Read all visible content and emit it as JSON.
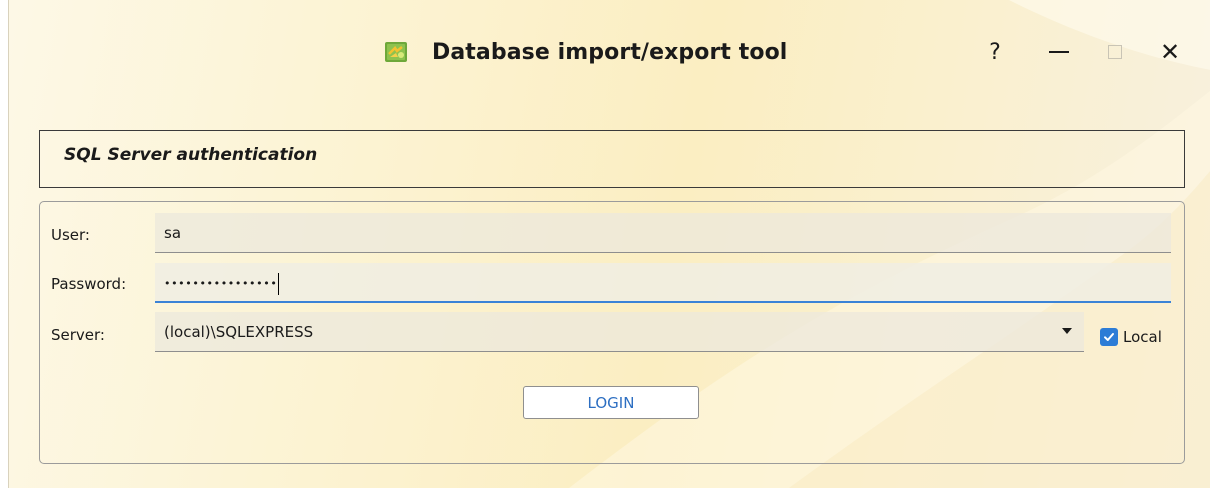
{
  "window": {
    "title": "Database import/export tool",
    "help_label": "?",
    "close_label": "✕"
  },
  "auth": {
    "title": "SQL Server authentication"
  },
  "form": {
    "user_label": "User:",
    "user_value": "sa",
    "password_label": "Password:",
    "password_value": "••••••••••••••••",
    "server_label": "Server:",
    "server_value": "(local)\\SQLEXPRESS",
    "local_label": "Local",
    "local_checked": true,
    "login_label": "LOGIN"
  },
  "colors": {
    "accent": "#2c7cd6",
    "focus_underline": "#3b83d6",
    "button_text": "#2d6fc2"
  }
}
